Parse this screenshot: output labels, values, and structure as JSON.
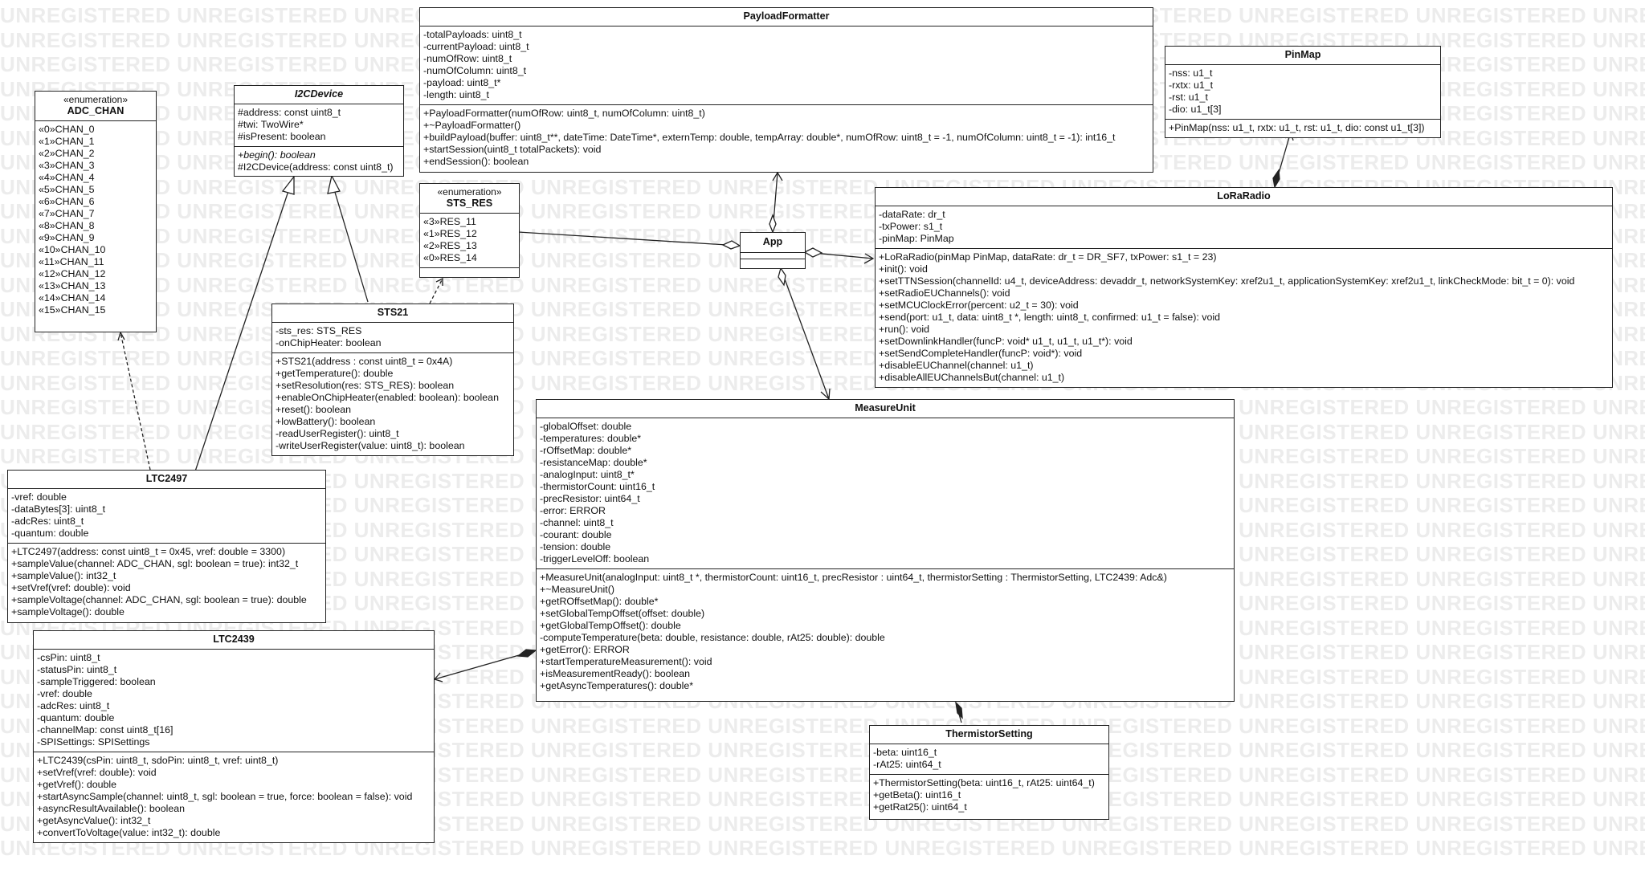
{
  "watermark": "UNREGISTERED UNREGISTERED UNREGISTERED UNREGISTERED UNREGISTERED UNREGISTERED UNREGISTERED UNREGISTERED UNREGISTERED UNREGISTERED UNREGISTERED UNREGISTERED",
  "classes": {
    "adc_chan": {
      "stereotype": "«enumeration»",
      "name": "ADC_CHAN",
      "literals": [
        "«0»CHAN_0",
        "«1»CHAN_1",
        "«2»CHAN_2",
        "«3»CHAN_3",
        "«4»CHAN_4",
        "«5»CHAN_5",
        "«6»CHAN_6",
        "«7»CHAN_7",
        "«8»CHAN_8",
        "«9»CHAN_9",
        "«10»CHAN_10",
        "«11»CHAN_11",
        "«12»CHAN_12",
        "«13»CHAN_13",
        "«14»CHAN_14",
        "«15»CHAN_15"
      ]
    },
    "i2cdevice": {
      "name": "I2CDevice",
      "attributes": [
        "#address: const uint8_t",
        "#twi: TwoWire*",
        "#isPresent: boolean"
      ],
      "operations": [
        "+begin(): boolean",
        "#I2CDevice(address: const uint8_t)"
      ]
    },
    "sts_res": {
      "stereotype": "«enumeration»",
      "name": "STS_RES",
      "literals": [
        "«3»RES_11",
        "«1»RES_12",
        "«2»RES_13",
        "«0»RES_14"
      ]
    },
    "payloadformatter": {
      "name": "PayloadFormatter",
      "attributes": [
        "-totalPayloads: uint8_t",
        "-currentPayload: uint8_t",
        "-numOfRow: uint8_t",
        "-numOfColumn: uint8_t",
        "-payload: uint8_t*",
        "-length: uint8_t"
      ],
      "operations": [
        "+PayloadFormatter(numOfRow: uint8_t, numOfColumn: uint8_t)",
        "+~PayloadFormatter()",
        "+buildPayload(buffer: uint8_t**, dateTime: DateTime*, externTemp: double, tempArray: double*, numOfRow: uint8_t = -1, numOfColumn: uint8_t = -1): int16_t",
        "+startSession(uint8_t totalPackets): void",
        "+endSession(): boolean"
      ]
    },
    "pinmap": {
      "name": "PinMap",
      "attributes": [
        "-nss: u1_t",
        "-rxtx: u1_t",
        "-rst: u1_t",
        "-dio: u1_t[3]"
      ],
      "operations": [
        "+PinMap(nss: u1_t, rxtx: u1_t, rst: u1_t, dio: const u1_t[3])"
      ]
    },
    "app": {
      "name": "App"
    },
    "loraradio": {
      "name": "LoRaRadio",
      "attributes": [
        "-dataRate: dr_t",
        "-txPower: s1_t",
        "-pinMap: PinMap"
      ],
      "operations": [
        "+LoRaRadio(pinMap PinMap, dataRate: dr_t = DR_SF7, txPower: s1_t = 23)",
        "+init(): void",
        "+setTTNSession(channelId: u4_t, deviceAddress: devaddr_t, networkSystemKey: xref2u1_t, applicationSystemKey: xref2u1_t, linkCheckMode: bit_t = 0): void",
        "+setRadioEUChannels(): void",
        "+setMCUClockError(percent: u2_t = 30): void",
        "+send(port: u1_t, data: uint8_t *, length: uint8_t, confirmed: u1_t = false): void",
        "+run(): void",
        "+setDownlinkHandler(funcP: void* u1_t, u1_t, u1_t*): void",
        "+setSendCompleteHandler(funcP: void*): void",
        "+disableEUChannel(channel: u1_t)",
        "+disableAllEUChannelsBut(channel: u1_t)"
      ]
    },
    "sts21": {
      "name": "STS21",
      "attributes": [
        "-sts_res: STS_RES",
        "-onChipHeater: boolean"
      ],
      "operations": [
        "+STS21(address : const uint8_t = 0x4A)",
        "+getTemperature(): double",
        "+setResolution(res: STS_RES): boolean",
        "+enableOnChipHeater(enabled: boolean): boolean",
        "+reset(): boolean",
        "+lowBattery(): boolean",
        "-readUserRegister(): uint8_t",
        "-writeUserRegister(value: uint8_t): boolean"
      ]
    },
    "measureunit": {
      "name": "MeasureUnit",
      "attributes": [
        "-globalOffset: double",
        "-temperatures: double*",
        "-rOffsetMap: double*",
        "-resistanceMap: double*",
        "-analogInput: uint8_t*",
        "-thermistorCount: uint16_t",
        "-precResistor: uint64_t",
        "-error: ERROR",
        "-channel: uint8_t",
        "-courant: double",
        "-tension: double",
        "-triggerLevelOff: boolean"
      ],
      "operations": [
        "+MeasureUnit(analogInput: uint8_t *, thermistorCount: uint16_t, precResistor : uint64_t, thermistorSetting : ThermistorSetting, LTC2439: Adc&)",
        "+~MeasureUnit()",
        "+getROffsetMap(): double*",
        "+setGlobalTempOffset(offset: double)",
        "+getGlobalTempOffset(): double",
        "-computeTemperature(beta: double, resistance: double, rAt25: double): double",
        "+getError(): ERROR",
        "+startTemperatureMeasurement(): void",
        "+isMeasurementReady(): boolean",
        "+getAsyncTemperatures(): double*"
      ]
    },
    "ltc2497": {
      "name": "LTC2497",
      "attributes": [
        "-vref: double",
        "-dataBytes[3]: uint8_t",
        "-adcRes: uint8_t",
        "-quantum: double"
      ],
      "operations": [
        "+LTC2497(address: const uint8_t = 0x45, vref: double = 3300)",
        "+sampleValue(channel: ADC_CHAN, sgl: boolean = true): int32_t",
        "+sampleValue(): int32_t",
        "+setVref(vref: double): void",
        "+sampleVoltage(channel: ADC_CHAN, sgl: boolean = true): double",
        "+sampleVoltage(): double"
      ]
    },
    "ltc2439": {
      "name": "LTC2439",
      "attributes": [
        "-csPin: uint8_t",
        "-statusPin: uint8_t",
        "-sampleTriggered: boolean",
        "-vref: double",
        "-adcRes: uint8_t",
        "-quantum: double",
        "-channelMap: const uint8_t[16]",
        "-SPISettings: SPISettings"
      ],
      "operations": [
        "+LTC2439(csPin: uint8_t, sdoPin: uint8_t, vref: uint8_t)",
        "+setVref(vref: double): void",
        "+getVref(): double",
        "+startAsyncSample(channel: uint8_t, sgl: boolean = true, force: boolean = false): void",
        "+asyncResultAvailable(): boolean",
        "+getAsyncValue(): int32_t",
        "+convertToVoltage(value: int32_t): double"
      ]
    },
    "thermistorsetting": {
      "name": "ThermistorSetting",
      "attributes": [
        "-beta: uint16_t",
        "-rAt25: uint64_t"
      ],
      "operations": [
        "+ThermistorSetting(beta: uint16_t, rAt25: uint64_t)",
        "+getBeta(): uint16_t",
        "+getRat25(): uint64_t"
      ]
    }
  }
}
